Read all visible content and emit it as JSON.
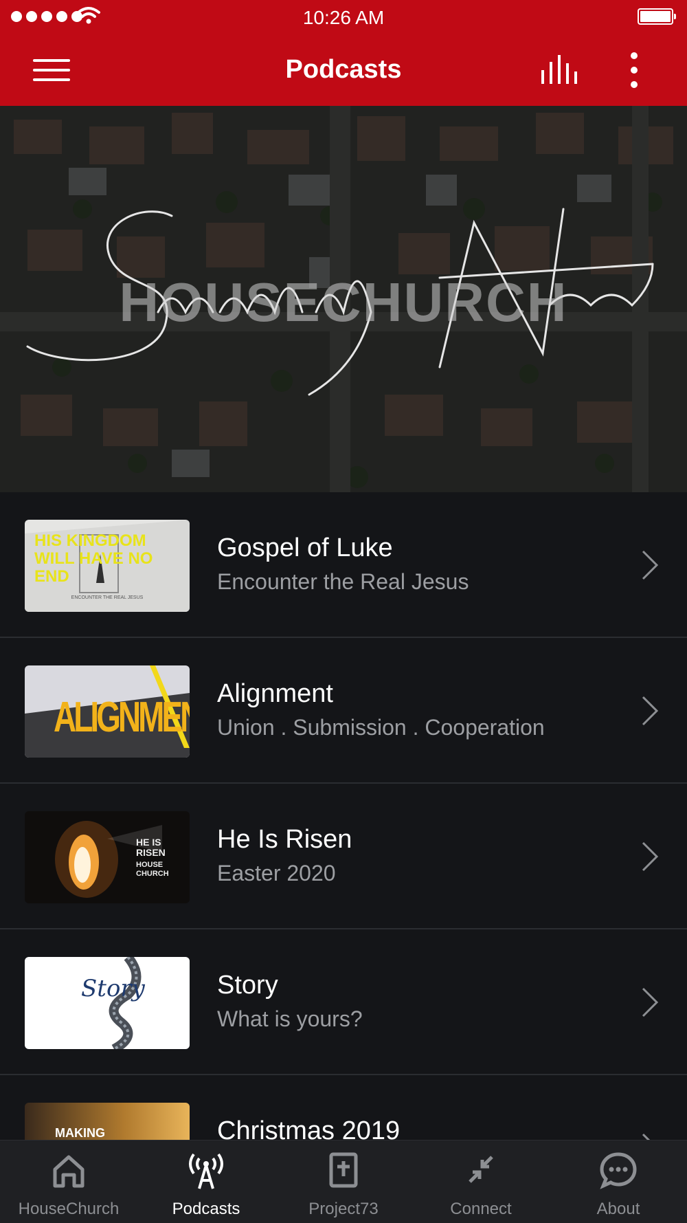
{
  "status_bar": {
    "time": "10:26 AM"
  },
  "header": {
    "title": "Podcasts"
  },
  "hero": {
    "overlay_text": "HOUSECHURCH",
    "script_text": "Sunday Notes"
  },
  "podcasts": [
    {
      "title": "Gospel of Luke",
      "subtitle": "Encounter the Real Jesus",
      "thumb_text": "HIS KINGDOM WILL HAVE NO END",
      "thumb_caption": "ENCOUNTER THE REAL JESUS"
    },
    {
      "title": "Alignment",
      "subtitle": "Union . Submission . Cooperation",
      "thumb_text": "ALIGNMENT"
    },
    {
      "title": "He Is Risen",
      "subtitle": "Easter 2020",
      "thumb_text": "HE IS RISEN",
      "thumb_caption": "HOUSE CHURCH"
    },
    {
      "title": "Story",
      "subtitle": "What is yours?",
      "thumb_text": "Story"
    },
    {
      "title": "Christmas 2019",
      "subtitle": "",
      "thumb_text": "MAKING"
    }
  ],
  "tabs": [
    {
      "label": "HouseChurch",
      "icon": "home-icon",
      "active": false
    },
    {
      "label": "Podcasts",
      "icon": "broadcast-icon",
      "active": true
    },
    {
      "label": "Project73",
      "icon": "bible-icon",
      "active": false
    },
    {
      "label": "Connect",
      "icon": "arrows-in-icon",
      "active": false
    },
    {
      "label": "About",
      "icon": "chat-bubble-icon",
      "active": false
    }
  ],
  "colors": {
    "brand_red": "#c00a15",
    "list_background": "#141518",
    "tab_bar": "#1f2023",
    "subtitle_gray": "#9d9fa3",
    "inactive_tab": "#8d8f93"
  }
}
